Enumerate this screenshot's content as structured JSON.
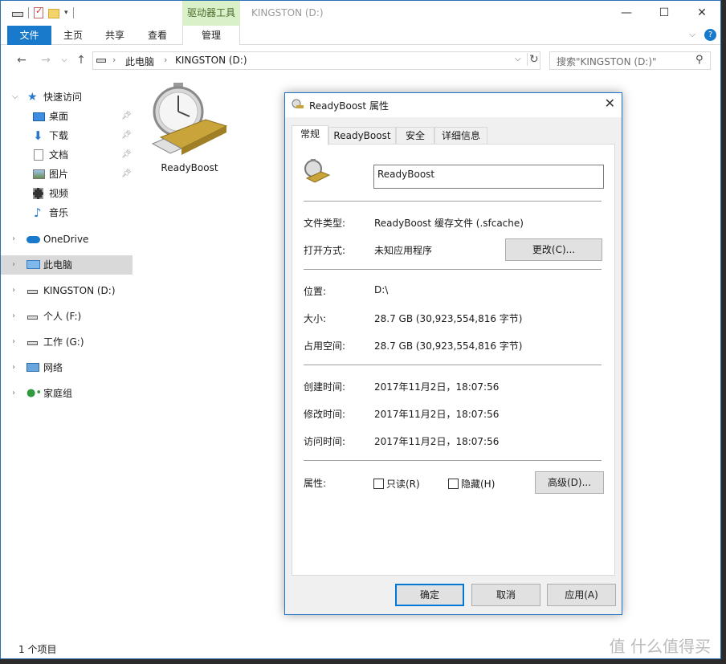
{
  "titlebar": {
    "context_tab": "驱动器工具",
    "window_title": "KINGSTON (D:)",
    "minimize": "—",
    "maximize": "☐",
    "close": "✕"
  },
  "ribbon": {
    "tabs": [
      "文件",
      "主页",
      "共享",
      "查看",
      "管理"
    ]
  },
  "address": {
    "segments": [
      "此电脑",
      "KINGSTON (D:)"
    ],
    "search_placeholder": "搜索\"KINGSTON (D:)\""
  },
  "nav": {
    "quick_access": "快速访问",
    "items": [
      "桌面",
      "下载",
      "文档",
      "图片",
      "视频",
      "音乐"
    ],
    "onedrive": "OneDrive",
    "this_pc": "此电脑",
    "drive_d": "KINGSTON (D:)",
    "drive_f": "个人 (F:)",
    "drive_g": "工作 (G:)",
    "network": "网络",
    "homegroup": "家庭组"
  },
  "content": {
    "file_name": "ReadyBoost"
  },
  "status": {
    "count": "1 个项目"
  },
  "watermark": "值 什么值得买",
  "dialog": {
    "title": "ReadyBoost 属性",
    "tabs": [
      "常规",
      "ReadyBoost",
      "安全",
      "详细信息"
    ],
    "name": "ReadyBoost",
    "file_type_label": "文件类型:",
    "file_type": "ReadyBoost 缓存文件 (.sfcache)",
    "opens_with_label": "打开方式:",
    "opens_with": "未知应用程序",
    "change_button": "更改(C)...",
    "location_label": "位置:",
    "location": "D:\\",
    "size_label": "大小:",
    "size": "28.7 GB (30,923,554,816 字节)",
    "size_on_disk_label": "占用空间:",
    "size_on_disk": "28.7 GB (30,923,554,816 字节)",
    "created_label": "创建时间:",
    "created": "2017年11月2日，18:07:56",
    "modified_label": "修改时间:",
    "modified": "2017年11月2日，18:07:56",
    "accessed_label": "访问时间:",
    "accessed": "2017年11月2日，18:07:56",
    "attributes_label": "属性:",
    "readonly": "只读(R)",
    "hidden": "隐藏(H)",
    "advanced_button": "高级(D)...",
    "ok": "确定",
    "cancel": "取消",
    "apply": "应用(A)"
  }
}
